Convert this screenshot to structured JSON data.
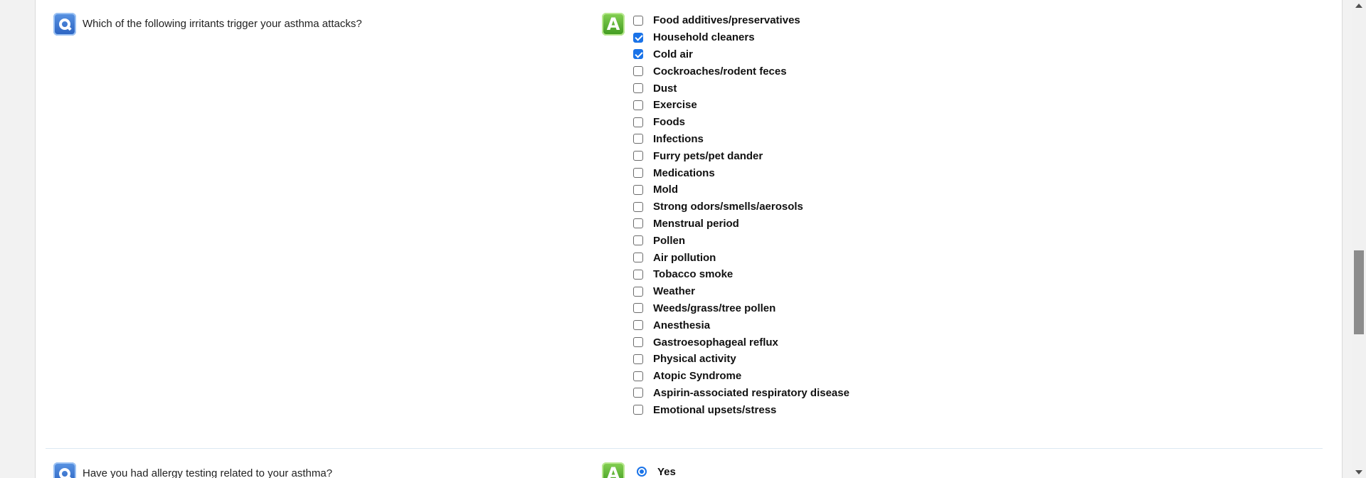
{
  "question1": {
    "badge": "Q",
    "text": "Which of the following irritants trigger your asthma attacks?",
    "answer_badge": "A",
    "options": [
      {
        "label": "Food additives/preservatives",
        "checked": false
      },
      {
        "label": "Household cleaners",
        "checked": true
      },
      {
        "label": "Cold air",
        "checked": true
      },
      {
        "label": "Cockroaches/rodent feces",
        "checked": false
      },
      {
        "label": "Dust",
        "checked": false
      },
      {
        "label": "Exercise",
        "checked": false
      },
      {
        "label": "Foods",
        "checked": false
      },
      {
        "label": "Infections",
        "checked": false
      },
      {
        "label": "Furry pets/pet dander",
        "checked": false
      },
      {
        "label": "Medications",
        "checked": false
      },
      {
        "label": "Mold",
        "checked": false
      },
      {
        "label": "Strong odors/smells/aerosols",
        "checked": false
      },
      {
        "label": "Menstrual period",
        "checked": false
      },
      {
        "label": "Pollen",
        "checked": false
      },
      {
        "label": "Air pollution",
        "checked": false
      },
      {
        "label": "Tobacco smoke",
        "checked": false
      },
      {
        "label": "Weather",
        "checked": false
      },
      {
        "label": "Weeds/grass/tree pollen",
        "checked": false
      },
      {
        "label": "Anesthesia",
        "checked": false
      },
      {
        "label": "Gastroesophageal reflux",
        "checked": false
      },
      {
        "label": "Physical activity",
        "checked": false
      },
      {
        "label": "Atopic Syndrome",
        "checked": false
      },
      {
        "label": "Aspirin-associated respiratory disease",
        "checked": false
      },
      {
        "label": "Emotional upsets/stress",
        "checked": false
      }
    ]
  },
  "question2": {
    "badge": "Q",
    "text": "Have you had allergy testing related to your asthma?",
    "answer_badge": "A",
    "selected_option": "Yes"
  },
  "colors": {
    "accent": "#1a73e8",
    "q_badge": "#2a62c1",
    "a_badge": "#3f9a1f",
    "divider": "#dce9f2"
  },
  "icons": {
    "question_badge": "question-badge-icon",
    "answer_badge": "answer-badge-icon"
  }
}
